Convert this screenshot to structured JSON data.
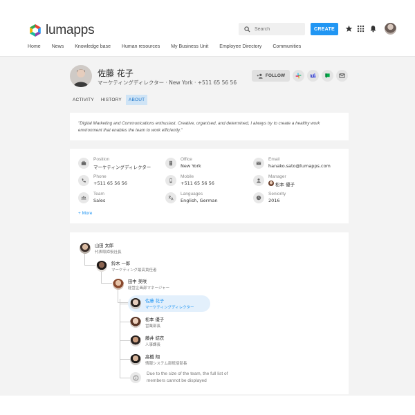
{
  "brand": {
    "name": "lumapps",
    "accent": "#2196f3"
  },
  "header": {
    "search_placeholder": "Search",
    "create_label": "CREATE"
  },
  "nav": [
    {
      "label": "Home"
    },
    {
      "label": "News"
    },
    {
      "label": "Knowledge base"
    },
    {
      "label": "Human resources"
    },
    {
      "label": "My Business Unit"
    },
    {
      "label": "Employee Directory"
    },
    {
      "label": "Communities"
    }
  ],
  "profile": {
    "name": "佐藤 花子",
    "subtitle": "マーケティングディレクター · New York · +511 65 56 56",
    "follow_label": "FOLLOW",
    "tabs": [
      {
        "label": "ACTIVITY"
      },
      {
        "label": "HISTORY"
      },
      {
        "label": "ABOUT",
        "active": true
      }
    ],
    "quote": "\"Digital Marketing and Communications enthusiast. Creative, organised, and determined, I always try to create a healthy work environment that enables the team to work efficiently.\""
  },
  "info": {
    "position": {
      "label": "Position",
      "value": "マーケティングディレクター",
      "icon": "briefcase-icon"
    },
    "office": {
      "label": "Office",
      "value": "New York",
      "icon": "building-icon"
    },
    "email": {
      "label": "Email",
      "value": "hanako.sato@lumapps.com",
      "icon": "mail-icon"
    },
    "phone": {
      "label": "Phone",
      "value": "+511 65 56 56",
      "icon": "phone-icon"
    },
    "mobile": {
      "label": "Mobile",
      "value": "+511 65 56 56",
      "icon": "mobile-icon"
    },
    "manager": {
      "label": "Manager",
      "value": "松本 優子",
      "icon": "manager-icon"
    },
    "team": {
      "label": "Team",
      "value": "Sales",
      "icon": "team-icon"
    },
    "languages": {
      "label": "Languages",
      "value": "English, German",
      "icon": "translate-icon"
    },
    "seniority": {
      "label": "Seniority",
      "value": "2016",
      "icon": "clock-icon"
    },
    "more_label": "More"
  },
  "org": {
    "nodes": [
      {
        "name": "山田 太郎",
        "title": "代表取締役社長"
      },
      {
        "name": "鈴木 一郎",
        "title": "マーケティング最高責任者"
      },
      {
        "name": "田中 美咲",
        "title": "経営企画部マネージャー"
      },
      {
        "name": "佐藤 花子",
        "title": "マーケティングディレクター"
      },
      {
        "name": "松本 優子",
        "title": "営業部長"
      },
      {
        "name": "藤井 結衣",
        "title": "人事課長"
      },
      {
        "name": "高橋 翔",
        "title": "情報システム部統括部長"
      }
    ],
    "note": "Due to the size of the team, the full list of members cannot be displayed"
  }
}
